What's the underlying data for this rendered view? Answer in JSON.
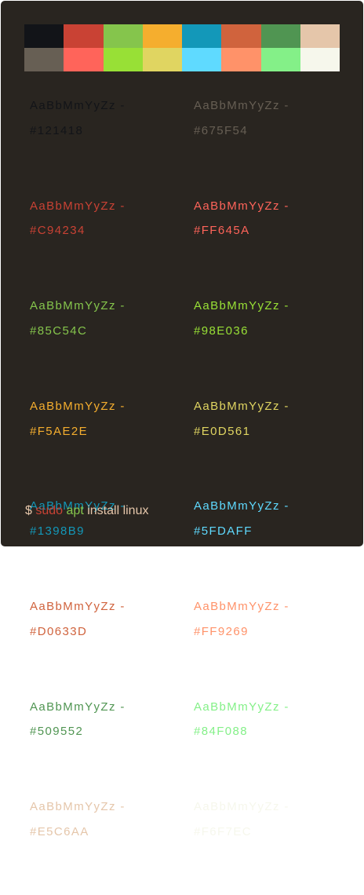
{
  "palette": {
    "normal": [
      "#121418",
      "#C94234",
      "#85C54C",
      "#F5AE2E",
      "#1398B9",
      "#D0633D",
      "#509552",
      "#E5C6AA"
    ],
    "bright": [
      "#675F54",
      "#FF645A",
      "#98E036",
      "#E0D561",
      "#5FDAFF",
      "#FF9269",
      "#84F088",
      "#F6F7EC"
    ]
  },
  "samples": {
    "sample_text": "AaBbMmYyZz -",
    "normal": [
      {
        "hex": "#121418",
        "color": "#121418"
      },
      {
        "hex": "#C94234",
        "color": "#C94234"
      },
      {
        "hex": "#85C54C",
        "color": "#85C54C"
      },
      {
        "hex": "#F5AE2E",
        "color": "#F5AE2E"
      },
      {
        "hex": "#1398B9",
        "color": "#1398B9"
      },
      {
        "hex": "#D0633D",
        "color": "#D0633D"
      },
      {
        "hex": "#509552",
        "color": "#509552"
      },
      {
        "hex": "#E5C6AA",
        "color": "#E5C6AA"
      }
    ],
    "bright": [
      {
        "hex": "#675F54",
        "color": "#675F54"
      },
      {
        "hex": "#FF645A",
        "color": "#FF645A"
      },
      {
        "hex": "#98E036",
        "color": "#98E036"
      },
      {
        "hex": "#E0D561",
        "color": "#E0D561"
      },
      {
        "hex": "#5FDAFF",
        "color": "#5FDAFF"
      },
      {
        "hex": "#FF9269",
        "color": "#FF9269"
      },
      {
        "hex": "#84F088",
        "color": "#84F088"
      },
      {
        "hex": "#F6F7EC",
        "color": "#F6F7EC"
      }
    ]
  },
  "command": {
    "prompt": "$",
    "sudo": "sudo",
    "apt": "apt",
    "rest": "install linux",
    "prompt_color": "#E5C6AA",
    "sudo_color": "#C94234",
    "apt_color": "#85C54C",
    "rest_color": "#E5C6AA"
  }
}
